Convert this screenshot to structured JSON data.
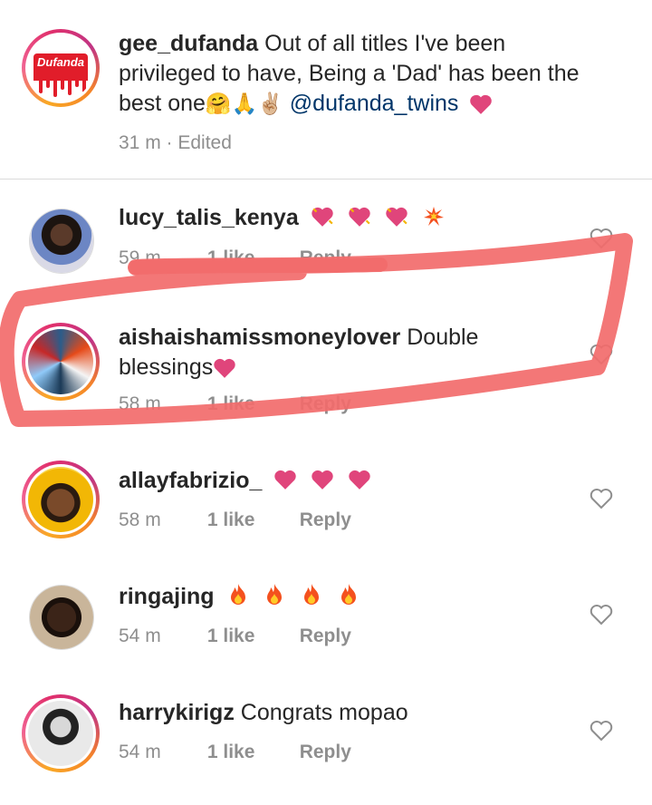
{
  "caption": {
    "username": "gee_dufanda",
    "text": "Out of all titles I've been privileged to have, Being a 'Dad' has been the best one",
    "emojis": "🤗🙏✌🏼",
    "mention": "@dufanda_twins",
    "logo_text": "Dufanda",
    "time": "31 m",
    "separator": "·",
    "edited": "Edited"
  },
  "comments": [
    {
      "username": "lucy_talis_kenya",
      "text": "",
      "time": "59 m",
      "likes": "1 like",
      "reply": "Reply"
    },
    {
      "username": "aishaishamissmoneylover",
      "text": "Double blessings",
      "time": "58 m",
      "likes": "1 like",
      "reply": "Reply"
    },
    {
      "username": "allayfabrizio_",
      "text": "",
      "time": "58 m",
      "likes": "1 like",
      "reply": "Reply"
    },
    {
      "username": "ringajing",
      "text": "",
      "time": "54 m",
      "likes": "1 like",
      "reply": "Reply"
    },
    {
      "username": "harrykirigz",
      "text": "Congrats mopao",
      "time": "54 m",
      "likes": "1 like",
      "reply": "Reply"
    }
  ],
  "colors": {
    "heart": "#e0457b",
    "annotation": "#f26b6b",
    "meta_gray": "#8e8e8e",
    "mention_blue": "#003569"
  }
}
